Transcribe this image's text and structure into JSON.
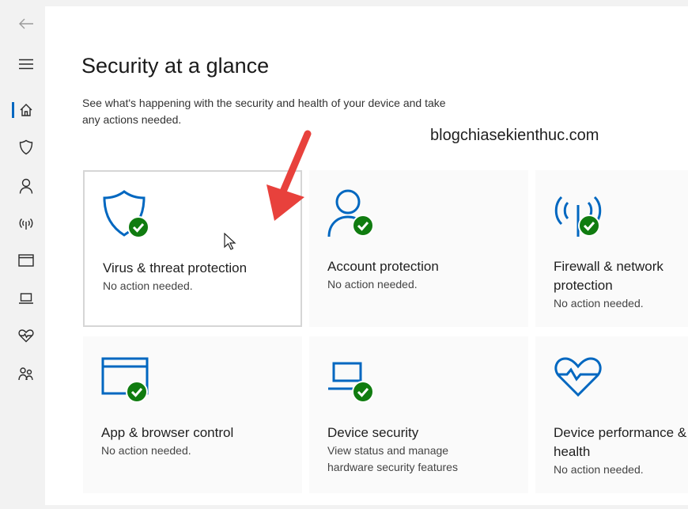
{
  "sidebar": {
    "items": [
      {
        "name": "back",
        "icon": "back-arrow-icon"
      },
      {
        "name": "menu",
        "icon": "hamburger-menu-icon"
      },
      {
        "name": "home",
        "icon": "home-icon",
        "active": true
      },
      {
        "name": "virus",
        "icon": "shield-icon"
      },
      {
        "name": "account",
        "icon": "person-icon"
      },
      {
        "name": "firewall",
        "icon": "antenna-icon"
      },
      {
        "name": "app-browser",
        "icon": "browser-window-icon"
      },
      {
        "name": "device-security",
        "icon": "laptop-icon"
      },
      {
        "name": "device-performance",
        "icon": "heart-pulse-icon"
      },
      {
        "name": "family",
        "icon": "family-icon"
      }
    ]
  },
  "main": {
    "title": "Security at a glance",
    "description": "See what's happening with the security and health of your device and take any actions needed.",
    "watermark": "blogchiasekienthuc.com",
    "cards": [
      {
        "title": "Virus & threat protection",
        "status": "No action needed.",
        "icon": "shield-check-icon"
      },
      {
        "title": "Account protection",
        "status": "No action needed.",
        "icon": "person-check-icon"
      },
      {
        "title": "Firewall & network protection",
        "status": "No action needed.",
        "icon": "antenna-check-icon"
      },
      {
        "title": "App & browser control",
        "status": "No action needed.",
        "icon": "browser-check-icon"
      },
      {
        "title": "Device security",
        "status": "View status and manage hardware security features",
        "icon": "laptop-check-icon"
      },
      {
        "title": "Device performance & health",
        "status": "No action needed.",
        "icon": "heart-pulse-icon"
      }
    ]
  },
  "colors": {
    "accent": "#0067c0",
    "ok_green": "#107c10",
    "arrow_red": "#e8413c"
  }
}
